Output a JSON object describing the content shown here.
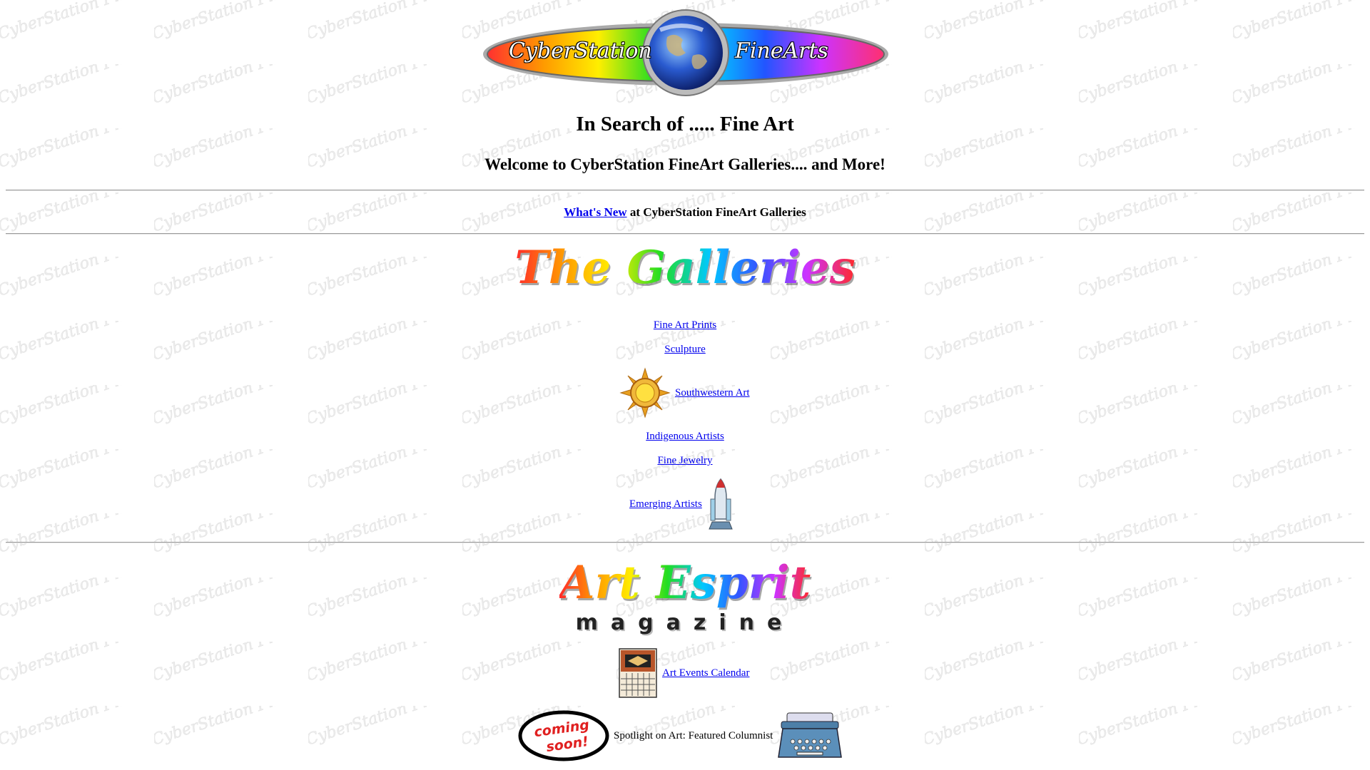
{
  "logo": {
    "left_text": "CyberStation",
    "right_text": "FineArts",
    "icon": "globe-icon"
  },
  "watermark": "CyberStation FineArts",
  "title": "In Search of ..... Fine Art",
  "welcome": "Welcome to CyberStation FineArt Galleries.... and More!",
  "whats_new": {
    "link": "What's New",
    "suffix": " at CyberStation FineArt Galleries"
  },
  "galleries": {
    "heading": "The Galleries",
    "items": [
      {
        "label": "Fine Art Prints"
      },
      {
        "label": "Sculpture"
      },
      {
        "label": "Southwestern Art",
        "icon": "sun-icon"
      },
      {
        "label": "Indigenous Artists"
      },
      {
        "label": "Fine Jewelry"
      },
      {
        "label": "Emerging Artists",
        "icon": "space-shuttle-icon"
      }
    ]
  },
  "esprit": {
    "heading": "Art Esprit",
    "subheading": "magazine",
    "calendar_link": "Art Events Calendar",
    "calendar_icon": "calendar-icon",
    "spotlight_text": "Spotlight on Art: Featured Columnist",
    "coming_soon": "coming soon!",
    "typewriter_icon": "typewriter-icon"
  },
  "colors": {
    "link": "#0000ee",
    "background": "#ffffff",
    "rule": "#9a9a9a"
  }
}
